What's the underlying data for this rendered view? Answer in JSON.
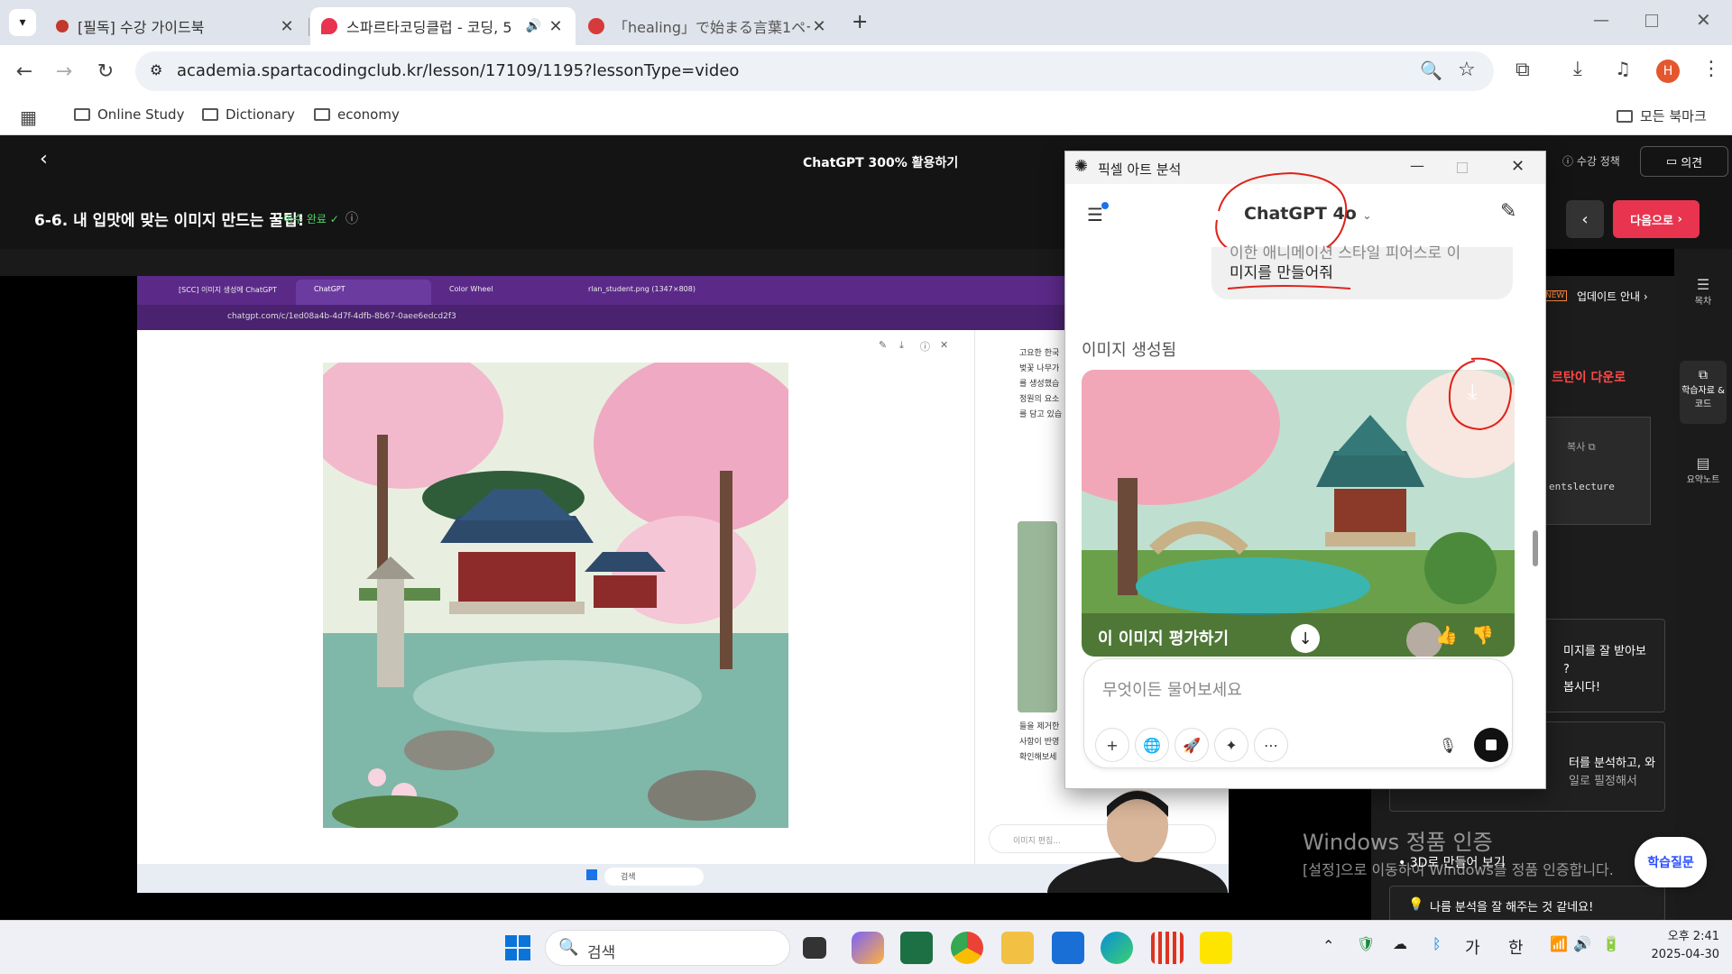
{
  "browser": {
    "tabs": [
      {
        "label": "[필독] 수강 가이드북"
      },
      {
        "label": "스파르타코딩클럽 - 코딩, 5"
      },
      {
        "label": "「healing」で始まる言葉1ページ目"
      }
    ],
    "url": "academia.spartacodingclub.kr/lesson/17109/1195?lessonType=video",
    "profile_initial": "H",
    "bookmarks": [
      "Online Study",
      "Dictionary",
      "economy"
    ],
    "all_bookmarks": "모든 북마크"
  },
  "lesson": {
    "course_title": "ChatGPT 300% 활용하기",
    "policy": "수강 정책",
    "feedback": "의견",
    "section_title": "6-6. 내 입맛에 맞는 이미지 만드는 꿀팁!",
    "complete": "이수 완료",
    "next": "다음으로"
  },
  "video": {
    "tabs": [
      "[SCC] 이미지 생성에 ChatGPT",
      "ChatGPT",
      "Color Wheel",
      "rlan_student.png (1347×808)"
    ],
    "url": "chatgpt.com/c/1ed08a4b-4d7f-4dfb-8b67-0aee6edcd2f3",
    "chat_text_1": [
      "고요한 한국",
      "벚꽃 나무가",
      "를 생성했습",
      "정원의 요소",
      "를 담고 있습"
    ],
    "chat_text_2": [
      "들을 제거한",
      "사항이 반영",
      "확인해보세"
    ],
    "input_placeholder": "이미지 편집...",
    "search": "검색"
  },
  "gpt": {
    "window_title": "픽셀 아트 분석",
    "model": "ChatGPT 4o",
    "user_message": [
      "이한 애니메이션 스타일 피어스로 이",
      "미지를 만들어줘"
    ],
    "image_status": "이미지 생성됨",
    "rate_image": "이 이미지 평가하기",
    "placeholder": "무엇이든 물어보세요"
  },
  "sidepanel": {
    "update": "업데이트 안내",
    "new_badge": "NEW",
    "download_text": "르탄이 다운로",
    "copy": "복사",
    "code_text": "entslecture",
    "msg1": [
      "미지를 잘 받아보",
      "?",
      "봅시다!"
    ],
    "msg2": [
      "터를 분석하고, 와",
      "일로 필정해서"
    ],
    "view3d": "3D로 만들어 보기",
    "tip": "나름 분석을 잘 해주는 것 같네요!",
    "rail": [
      "목차",
      "학습자료 & 코드",
      "요약노트"
    ],
    "help": "학습질문"
  },
  "watermark": {
    "title": "Windows 정품 인증",
    "sub": "[설정]으로 이동하여 Windows를 정품 인증합니다."
  },
  "taskbar": {
    "search": "검색",
    "ime1": "가",
    "ime2": "한",
    "time": "오후 2:41",
    "date": "2025-04-30"
  },
  "colors": {
    "accent_red": "#e8344e",
    "purple": "#5b2a88",
    "annotation": "#e0201a"
  }
}
